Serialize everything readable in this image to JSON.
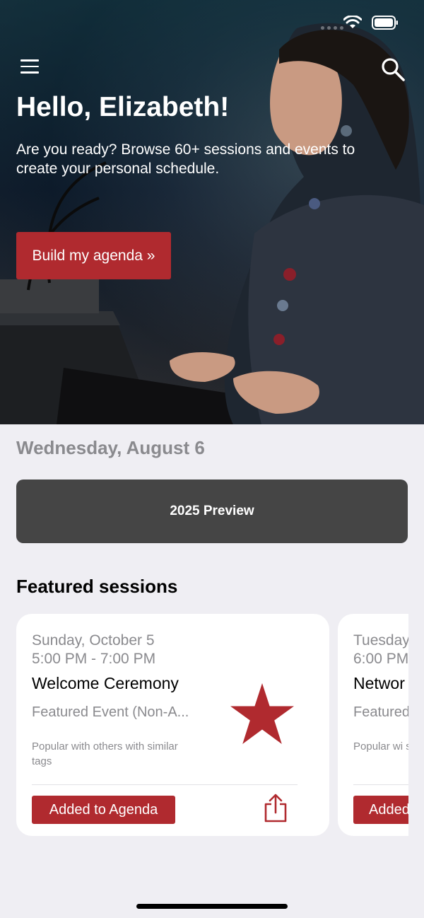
{
  "status": {
    "wifi_icon": "wifi-icon",
    "battery_icon": "battery-icon"
  },
  "header": {
    "menu_icon": "hamburger-menu-icon",
    "search_icon": "search-icon",
    "greeting": "Hello, Elizabeth!",
    "subtitle": "Are you ready? Browse 60+ sessions and events to create your personal schedule.",
    "cta_label": "Build my agenda »"
  },
  "main": {
    "date_heading": "Wednesday, August 6",
    "preview_label": "2025 Preview",
    "featured_title": "Featured sessions"
  },
  "featured": [
    {
      "date": "Sunday, October 5",
      "time": "5:00 PM - 7:00 PM",
      "title": "Welcome Ceremony",
      "category": "Featured Event (Non-A...",
      "note": "Popular with others with similar tags",
      "button_label": "Added to Agenda",
      "starred": true
    },
    {
      "date": "Tuesday",
      "time": "6:00 PM",
      "title": "Networ",
      "category": "Featured",
      "note": "Popular wi similar tags",
      "button_label": "Added"
    }
  ],
  "colors": {
    "accent": "#b02a2f",
    "preview_bg": "#454545",
    "page_bg": "#efeef3",
    "muted_text": "#8a8a8e"
  }
}
